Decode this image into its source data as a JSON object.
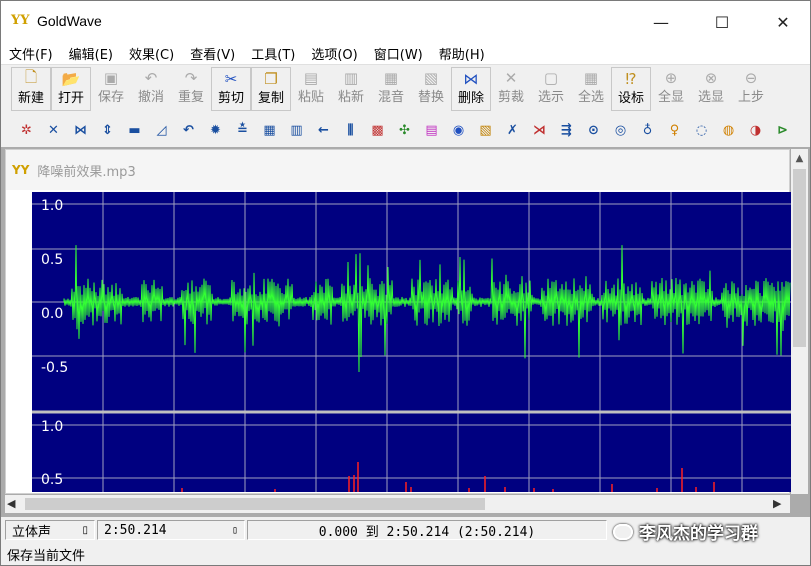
{
  "window": {
    "logo": "YY",
    "title": "GoldWave",
    "minimize_glyph": "—",
    "maximize_glyph": "☐",
    "close_glyph": "✕"
  },
  "menu": [
    "文件(F)",
    "编辑(E)",
    "效果(C)",
    "查看(V)",
    "工具(T)",
    "选项(O)",
    "窗口(W)",
    "帮助(H)"
  ],
  "toolbar1": [
    {
      "label": "新建",
      "icon": "new-file-icon",
      "enabled": true
    },
    {
      "label": "打开",
      "icon": "open-folder-icon",
      "enabled": true
    },
    {
      "label": "保存",
      "icon": "save-disk-icon",
      "enabled": false
    },
    {
      "label": "撤消",
      "icon": "undo-icon",
      "enabled": false
    },
    {
      "label": "重复",
      "icon": "redo-icon",
      "enabled": false
    },
    {
      "label": "剪切",
      "icon": "scissors-icon",
      "enabled": true
    },
    {
      "label": "复制",
      "icon": "copy-icon",
      "enabled": true
    },
    {
      "label": "粘贴",
      "icon": "paste-icon",
      "enabled": false
    },
    {
      "label": "粘新",
      "icon": "paste-new-icon",
      "enabled": false
    },
    {
      "label": "混音",
      "icon": "mix-icon",
      "enabled": false
    },
    {
      "label": "替换",
      "icon": "replace-icon",
      "enabled": false
    },
    {
      "label": "删除",
      "icon": "delete-icon",
      "enabled": true
    },
    {
      "label": "剪裁",
      "icon": "trim-icon",
      "enabled": false
    },
    {
      "label": "选示",
      "icon": "select-view-icon",
      "enabled": false
    },
    {
      "label": "全选",
      "icon": "select-all-icon",
      "enabled": false
    },
    {
      "label": "设标",
      "icon": "set-marker-icon",
      "enabled": true
    },
    {
      "label": "全显",
      "icon": "show-all-icon",
      "enabled": false
    },
    {
      "label": "选显",
      "icon": "show-selection-icon",
      "enabled": false
    },
    {
      "label": "上步",
      "icon": "previous-zoom-icon",
      "enabled": false
    }
  ],
  "toolbar2": [
    {
      "icon": "effect-icon-1",
      "glyph": "✲",
      "color": "#c03030"
    },
    {
      "icon": "effect-icon-2",
      "glyph": "✕",
      "color": "#1a4fa0"
    },
    {
      "icon": "effect-icon-3",
      "glyph": "⋈",
      "color": "#1a4fa0"
    },
    {
      "icon": "effect-icon-4",
      "glyph": "⇕",
      "color": "#1a4fa0"
    },
    {
      "icon": "effect-icon-5",
      "glyph": "▬",
      "color": "#1a4fa0"
    },
    {
      "icon": "effect-icon-6",
      "glyph": "◿",
      "color": "#1a4fa0"
    },
    {
      "icon": "effect-icon-7",
      "glyph": "↶",
      "color": "#1a4fa0"
    },
    {
      "icon": "effect-icon-8",
      "glyph": "✹",
      "color": "#1a4fa0"
    },
    {
      "icon": "effect-icon-9",
      "glyph": "≛",
      "color": "#1a4fa0"
    },
    {
      "icon": "effect-icon-10",
      "glyph": "▦",
      "color": "#1a4fa0"
    },
    {
      "icon": "effect-icon-11",
      "glyph": "▥",
      "color": "#1a4fa0"
    },
    {
      "icon": "effect-icon-12",
      "glyph": "←",
      "color": "#1a4fa0"
    },
    {
      "icon": "effect-icon-13",
      "glyph": "⫼",
      "color": "#1a4fa0"
    },
    {
      "icon": "effect-icon-14",
      "glyph": "▩",
      "color": "#c03030"
    },
    {
      "icon": "effect-icon-15",
      "glyph": "✣",
      "color": "#2a8a2a"
    },
    {
      "icon": "effect-icon-16",
      "glyph": "▤",
      "color": "#c030c0"
    },
    {
      "icon": "effect-icon-17",
      "glyph": "◉",
      "color": "#2050c0"
    },
    {
      "icon": "effect-icon-18",
      "glyph": "▧",
      "color": "#c08000"
    },
    {
      "icon": "effect-icon-19",
      "glyph": "✗",
      "color": "#1a4fa0"
    },
    {
      "icon": "effect-icon-20",
      "glyph": "⋊",
      "color": "#c03030"
    },
    {
      "icon": "effect-icon-21",
      "glyph": "⇶",
      "color": "#1a4fa0"
    },
    {
      "icon": "effect-icon-22",
      "glyph": "⊙",
      "color": "#1a4fa0"
    },
    {
      "icon": "effect-icon-23",
      "glyph": "◎",
      "color": "#1a4fa0"
    },
    {
      "icon": "effect-icon-24",
      "glyph": "♁",
      "color": "#1a4fa0"
    },
    {
      "icon": "effect-icon-25",
      "glyph": "♀",
      "color": "#d08000"
    },
    {
      "icon": "effect-icon-26",
      "glyph": "◌",
      "color": "#1a4fa0"
    },
    {
      "icon": "effect-icon-27",
      "glyph": "◍",
      "color": "#d08000"
    },
    {
      "icon": "effect-icon-28",
      "glyph": "◑",
      "color": "#c03030"
    },
    {
      "icon": "effect-icon-29",
      "glyph": "⊳",
      "color": "#2a8a2a"
    }
  ],
  "document": {
    "logo": "YY",
    "filename": "降噪前效果.mp3"
  },
  "waveform": {
    "background": "#000080",
    "grid_color": "#a0a0c0",
    "top_channel": {
      "color": "#33ff33",
      "labels": [
        "1.0",
        "0.5",
        "0.0",
        "-0.5"
      ]
    },
    "bottom_channel": {
      "color": "#ff2020",
      "labels": [
        "1.0",
        "0.5"
      ]
    }
  },
  "status": {
    "channel_mode": "立体声",
    "duration": "2:50.214",
    "selection": "0.000 到 2:50.214 (2:50.214)",
    "message": "保存当前文件",
    "watermark": "李风杰的学习群"
  }
}
